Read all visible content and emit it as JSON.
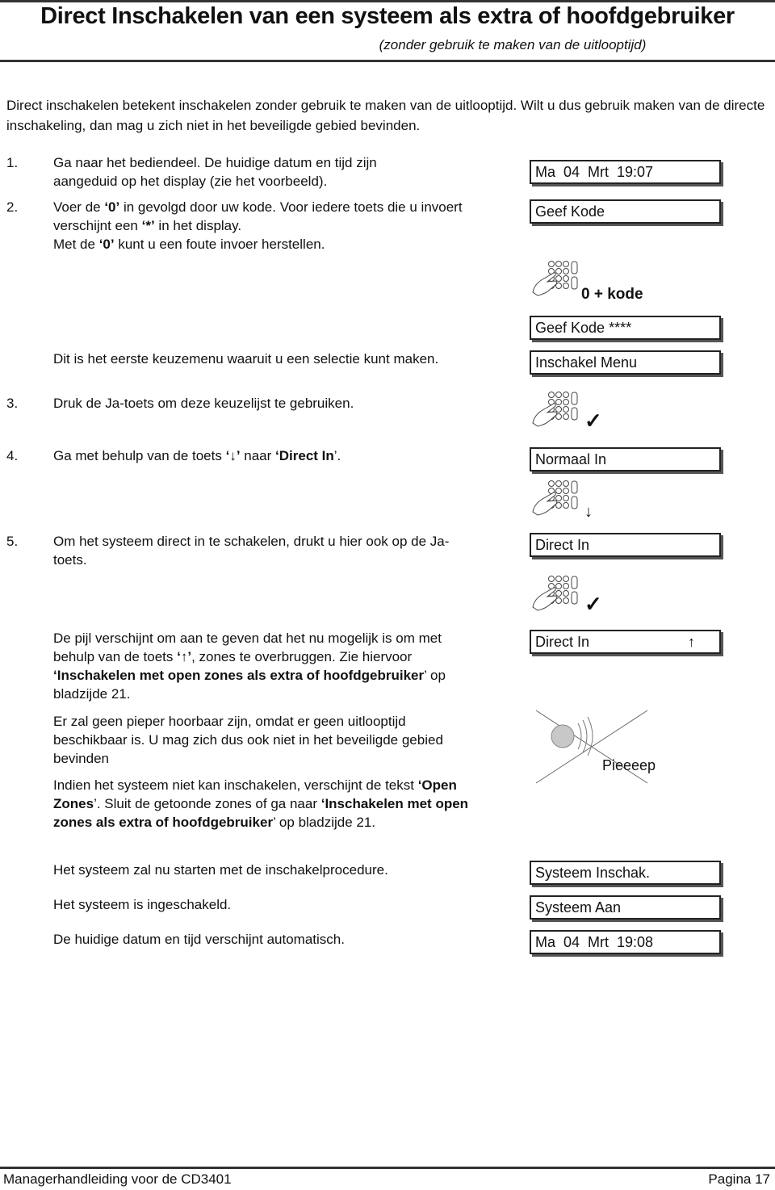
{
  "header": {
    "title": "Direct Inschakelen van een systeem als extra of hoofdgebruiker",
    "subtitle": "(zonder gebruik te maken van de uitlooptijd)"
  },
  "intro": "Direct inschakelen betekent inschakelen zonder gebruik te maken van de uitlooptijd. Wilt u dus gebruik maken van de directe inschakeling, dan mag u zich niet in het beveiligde gebied bevinden.",
  "steps": [
    {
      "num": "1.",
      "text": "Ga naar het bediendeel. De huidige datum en tijd zijn aangeduid op het display (zie het voorbeeld)."
    },
    {
      "num": "2.",
      "text_a": "Voer de ",
      "bold_a": "‘0’",
      "text_b": " in gevolgd door uw kode. Voor iedere toets die u invoert verschijnt een ",
      "bold_b": "‘*’",
      "text_c": " in het display.",
      "text_d": "Met de ",
      "bold_d": "‘0’",
      "text_e": " kunt u een foute invoer herstellen."
    },
    {
      "num": "",
      "text": "Dit is het eerste keuzemenu waaruit u een selectie kunt maken."
    },
    {
      "num": "3.",
      "text": "Druk de Ja-toets om deze keuzelijst te gebruiken."
    },
    {
      "num": "4.",
      "text_a": "Ga met behulp van de toets ",
      "bold_a": "‘↓’",
      "text_b": " naar ",
      "bold_b": "‘Direct In",
      "text_c": "’."
    },
    {
      "num": "5.",
      "text": "Om het systeem direct in te schakelen, drukt u hier ook op de Ja-toets."
    }
  ],
  "paragraphs": {
    "arrow_note": {
      "t1": "De pijl verschijnt om aan te geven dat het nu mogelijk is om met behulp van de toets ",
      "b1": "‘↑’",
      "t2": ", zones te overbruggen. Zie hiervoor ",
      "b2": "‘Inschakelen met open zones als extra of hoofdgebruiker",
      "t3": "’ op bladzijde 21."
    },
    "no_beep": "Er zal geen pieper hoorbaar zijn, omdat er geen uitlooptijd beschikbaar is. U mag zich dus ook niet in het beveiligde gebied bevinden",
    "open_zones": {
      "t1": "Indien het systeem niet kan inschakelen, verschijnt de tekst ",
      "b1": "‘Open Zones",
      "t2": "’. Sluit de getoonde zones of ga naar ",
      "b2": "‘Inschakelen met open zones als extra of hoofdgebruiker",
      "t3": "’ op bladzijde 21."
    },
    "starting": "Het systeem zal nu starten met de inschakelprocedure.",
    "armed": "Het systeem is ingeschakeld.",
    "datetime": "De huidige datum en tijd verschijnt automatisch."
  },
  "displays": {
    "d1": "Ma  04  Mrt  19:07",
    "d2": "Geef Kode",
    "d3": "Geef Kode ****",
    "d4": "Inschakel Menu",
    "d5": "Normaal In",
    "d6": "Direct In",
    "d7": "Direct In",
    "d7_arrow": "↑",
    "d8": "Systeem Inschak.",
    "d9": "Systeem Aan",
    "d10": "Ma  04  Mrt  19:08"
  },
  "keypad_labels": {
    "zero_code": "0 + kode",
    "check": "✓",
    "down": "↓"
  },
  "beep_label": "Pieeeep",
  "footer": {
    "left": "Managerhandleiding voor de CD3401",
    "right": "Pagina 17"
  }
}
